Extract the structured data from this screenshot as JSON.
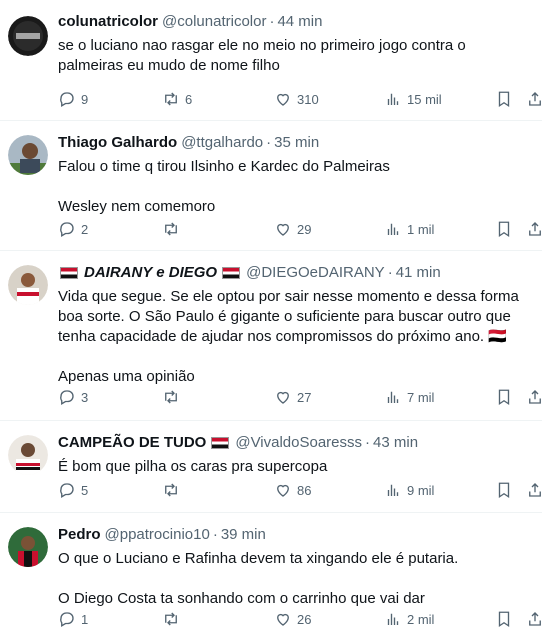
{
  "tweets": [
    {
      "name": "colunatricolor",
      "flags_after_name": 0,
      "handle": "@colunatricolor",
      "time": "44 min",
      "text": "se o luciano nao rasgar ele no meio no primeiro jogo contra o palmeiras eu mudo de nome filho",
      "replies": "9",
      "retweets": "6",
      "likes": "310",
      "views": "15 mil"
    },
    {
      "name": "Thiago Galhardo",
      "flags_after_name": 0,
      "handle": "@ttgalhardo",
      "time": "35 min",
      "text": "Falou o time q tirou Ilsinho e Kardec do Palmeiras\n\nWesley nem comemoro",
      "replies": "2",
      "retweets": "",
      "likes": "29",
      "views": "1 mil"
    },
    {
      "name": "DAIRANY e DIEGO",
      "flags_after_name": 1,
      "handle": "@DIEGOeDAIRANY",
      "time": "41 min",
      "text": "Vida que segue. Se ele optou por sair nesse momento e dessa forma boa sorte. O São Paulo é gigante o suficiente para buscar outro que tenha capacidade de ajudar nos compromissos do próximo ano. 🇾🇪\n\nApenas uma opinião",
      "replies": "3",
      "retweets": "",
      "likes": "27",
      "views": "7 mil"
    },
    {
      "name": "CAMPEÃO DE TUDO",
      "flags_after_name": 1,
      "handle": "@VivaldoSoaresss",
      "time": "43 min",
      "text": "É bom que pilha os caras pra supercopa",
      "replies": "5",
      "retweets": "",
      "likes": "86",
      "views": "9 mil"
    },
    {
      "name": "Pedro",
      "flags_after_name": 0,
      "handle": "@ppatrocinio10",
      "time": "39 min",
      "text": "O que o Luciano e Rafinha devem ta xingando ele é putaria.\n\nO Diego Costa ta sonhando com o carrinho que vai dar",
      "replies": "1",
      "retweets": "",
      "likes": "26",
      "views": "2 mil"
    }
  ],
  "colors": {
    "text": "#0f1419",
    "secondary": "#536471",
    "divider": "#eff3f4",
    "flag_red": "#c8102e",
    "flag_black": "#111111"
  },
  "icons": [
    "reply-icon",
    "retweet-icon",
    "like-icon",
    "views-icon",
    "bookmark-icon",
    "share-icon"
  ]
}
